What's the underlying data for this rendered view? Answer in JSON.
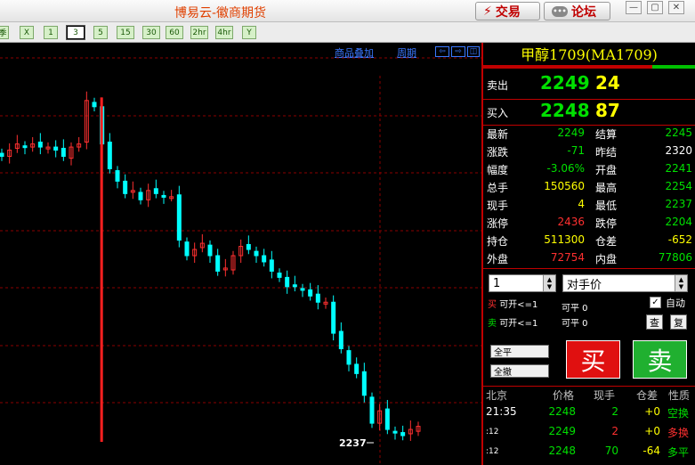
{
  "window": {
    "title": "博易云-徽商期货",
    "trade_label": "交易",
    "forum_label": "论坛"
  },
  "periods": [
    "季",
    "X",
    "1",
    "3",
    "5",
    "15",
    "30",
    "60",
    "2hr",
    "4hr",
    "Y"
  ],
  "chart_links": {
    "overlay": "商品叠加",
    "period": "周期"
  },
  "chart_data": {
    "type": "candlestick",
    "series_name": "",
    "latest_label": "2237",
    "close_path": [
      2262,
      2264,
      2266,
      2265,
      2266,
      2265,
      2265,
      2264,
      2262,
      2265,
      2266,
      2280,
      2278,
      2266,
      2258,
      2254,
      2250,
      2251,
      2248,
      2251,
      2250,
      2249,
      2249,
      2235,
      2230,
      2232,
      2234,
      2230,
      2225,
      2226,
      2230,
      2233,
      2232,
      2230,
      2228,
      2225,
      2223,
      2220,
      2220,
      2219,
      2217,
      2215,
      2215,
      2205,
      2200,
      2195,
      2192,
      2185,
      2176,
      2180,
      2174,
      2173,
      2172,
      2174,
      2175
    ],
    "volume_spike_index": 13,
    "ylim": [
      2170,
      2290
    ]
  },
  "quote": {
    "name": "甲醇1709(MA1709)",
    "ask_label": "卖出",
    "ask_price": "2249",
    "ask_vol": "24",
    "bid_label": "买入",
    "bid_price": "2248",
    "bid_vol": "87",
    "rows": [
      {
        "l1": "最新",
        "v1": "2249",
        "c1": "g",
        "l2": "结算",
        "v2": "2245",
        "c2": "g"
      },
      {
        "l1": "涨跌",
        "v1": "-71",
        "c1": "g",
        "l2": "昨结",
        "v2": "2320",
        "c2": "w"
      },
      {
        "l1": "幅度",
        "v1": "-3.06%",
        "c1": "g",
        "l2": "开盘",
        "v2": "2241",
        "c2": "g"
      },
      {
        "l1": "总手",
        "v1": "150560",
        "c1": "y",
        "l2": "最高",
        "v2": "2254",
        "c2": "g"
      },
      {
        "l1": "现手",
        "v1": "4",
        "c1": "y",
        "l2": "最低",
        "v2": "2237",
        "c2": "g"
      },
      {
        "l1": "涨停",
        "v1": "2436",
        "c1": "r",
        "l2": "跌停",
        "v2": "2204",
        "c2": "g"
      },
      {
        "l1": "持仓",
        "v1": "511300",
        "c1": "y",
        "l2": "仓差",
        "v2": "-652",
        "c2": "y"
      },
      {
        "l1": "外盘",
        "v1": "72754",
        "c1": "r",
        "l2": "内盘",
        "v2": "77806",
        "c2": "g"
      }
    ]
  },
  "order": {
    "qty": "1",
    "price_type": "对手价",
    "auto_label": "自动",
    "buy_label": "买",
    "buy_open": "可开<=1",
    "buy_close": "可平 0",
    "sell_label": "卖",
    "sell_open": "可开<=1",
    "sell_close": "可平 0",
    "check_btn": "查",
    "copy_btn": "复",
    "close_all": "全平",
    "cancel_all": "全撤",
    "buy_big": "买",
    "sell_big": "卖"
  },
  "ticks": {
    "headers": [
      "北京",
      "价格",
      "现手",
      "仓差",
      "性质"
    ],
    "rows": [
      {
        "time": "21:35",
        "price": "2248",
        "vol": "2",
        "diff": "+0",
        "nature": "空换",
        "nc": "g"
      },
      {
        "time": ":12",
        "price": "2249",
        "vol": "2",
        "diff": "+0",
        "nature": "多换",
        "nc": "r"
      },
      {
        "time": ":12",
        "price": "2248",
        "vol": "70",
        "diff": "-64",
        "nature": "多平",
        "nc": "g"
      }
    ]
  },
  "colors": {
    "up": "#ff3030",
    "down": "#00ffff",
    "grid": "#8b0000",
    "accent": "#c00000"
  }
}
